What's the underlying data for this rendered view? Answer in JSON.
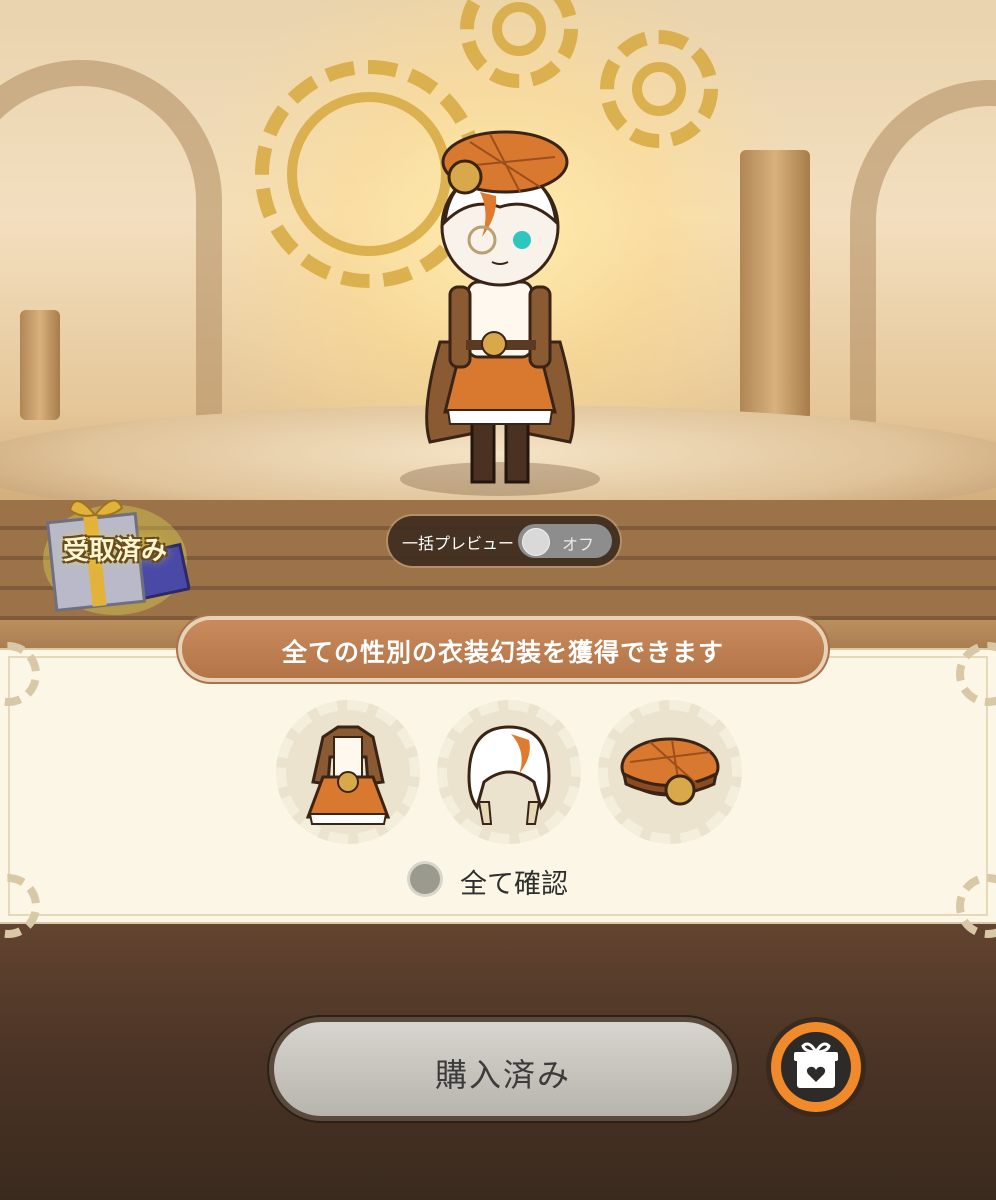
{
  "gift": {
    "status": "受取済み",
    "icon": "gift-box-icon"
  },
  "preview": {
    "label": "一括プレビュー",
    "toggle_state": "オフ"
  },
  "banner": {
    "text": "全ての性別の衣装幻装を獲得できます"
  },
  "items": [
    {
      "icon": "costume-outfit-icon"
    },
    {
      "icon": "hairstyle-icon"
    },
    {
      "icon": "beret-hat-icon"
    }
  ],
  "confirm": {
    "label": "全て確認"
  },
  "buy_button": {
    "label": "購入済み"
  },
  "gift_button": {
    "icon": "gift-heart-icon"
  },
  "colors": {
    "accent_orange": "#f08a2a",
    "banner_brown": "#b37447",
    "panel_cream": "#fbf6e6"
  }
}
